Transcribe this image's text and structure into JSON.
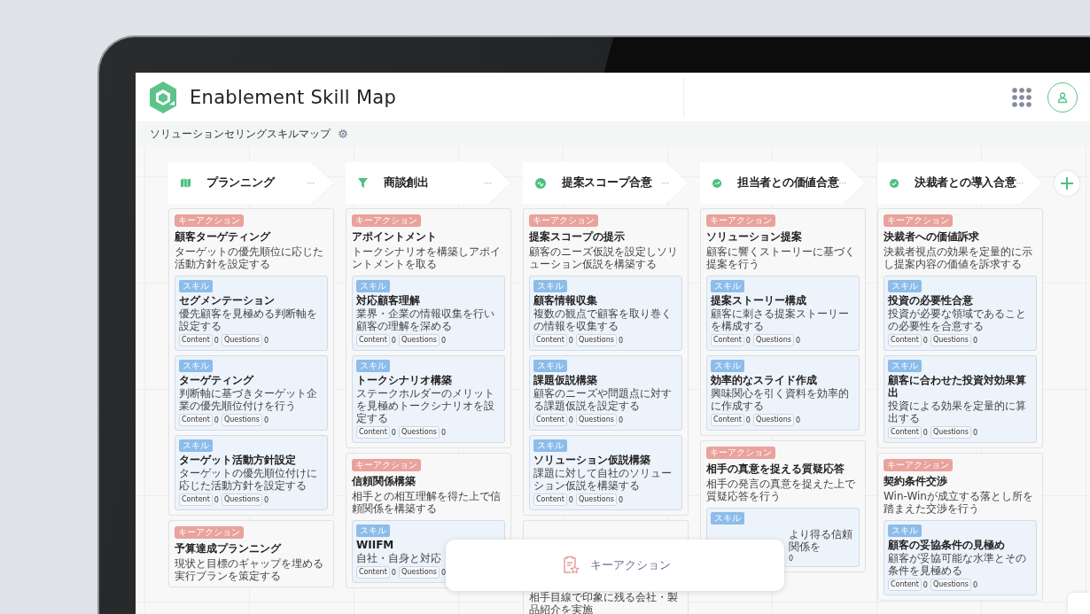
{
  "app": {
    "title": "Enablement Skill Map"
  },
  "map_title": "ソリューションセリングスキルマップ",
  "stages": [
    {
      "title": "プランニング",
      "menu": "···",
      "key_actions": [
        {
          "badge": "キーアクション",
          "title": "顧客ターゲティング",
          "description": "ターゲットの優先順位に応じた活動方針を設定する",
          "skills": [
            {
              "badge": "スキル",
              "title": "セグメンテーション",
              "description": "優先顧客を見極める判断軸を設定する",
              "stats": [
                {
                  "label": "Content",
                  "count": "0"
                },
                {
                  "label": "Questions",
                  "count": "0"
                }
              ]
            },
            {
              "badge": "スキル",
              "title": "ターゲティング",
              "description": "判断軸に基づきターゲット企業の優先順位付けを行う",
              "stats": [
                {
                  "label": "Content",
                  "count": "0"
                },
                {
                  "label": "Questions",
                  "count": "0"
                }
              ]
            },
            {
              "badge": "スキル",
              "title": "ターゲット活動方針設定",
              "description": "ターゲットの優先順位付けに応じた活動方針を設定する",
              "stats": [
                {
                  "label": "Content",
                  "count": "0"
                },
                {
                  "label": "Questions",
                  "count": "0"
                }
              ]
            }
          ]
        },
        {
          "badge": "キーアクション",
          "title": "予算達成プランニング",
          "description": "現状と目標のギャップを埋める実行プランを策定する"
        }
      ]
    },
    {
      "title": "商談創出",
      "menu": "···",
      "key_actions": [
        {
          "badge": "キーアクション",
          "title": "アポイントメント",
          "description": "トークシナリオを構築しアポイントメントを取る",
          "skills": [
            {
              "badge": "スキル",
              "title": "対応顧客理解",
              "description": "業界・企業の情報収集を行い顧客の理解を深める",
              "stats": [
                {
                  "label": "Content",
                  "count": "0"
                },
                {
                  "label": "Questions",
                  "count": "0"
                }
              ]
            },
            {
              "badge": "スキル",
              "title": "トークシナリオ構築",
              "description": "ステークホルダーのメリットを見極めトークシナリオを設定する",
              "stats": [
                {
                  "label": "Content",
                  "count": "0"
                },
                {
                  "label": "Questions",
                  "count": "0"
                }
              ]
            }
          ]
        },
        {
          "badge": "キーアクション",
          "title": "信頼関係構築",
          "description": "相手との相互理解を得た上で信頼関係を構築する",
          "skills": [
            {
              "badge": "スキル",
              "title": "WIIFM",
              "description": "自社・自身と対応",
              "stats": [
                {
                  "label": "Content",
                  "count": "0"
                },
                {
                  "label": "Questions",
                  "count": "0"
                }
              ]
            }
          ]
        }
      ]
    },
    {
      "title": "提案スコープ合意",
      "menu": "···",
      "key_actions": [
        {
          "badge": "キーアクション",
          "title": "提案スコープの提示",
          "description": "顧客のニーズ仮説を設定しソリューション仮説を構築する",
          "skills": [
            {
              "badge": "スキル",
              "title": "顧客情報収集",
              "description": "複数の観点で顧客を取り巻くの情報を収集する",
              "stats": [
                {
                  "label": "Content",
                  "count": "0"
                },
                {
                  "label": "Questions",
                  "count": "0"
                }
              ]
            },
            {
              "badge": "スキル",
              "title": "課題仮説構築",
              "description": "顧客のニーズや問題点に対する課題仮説を設定する",
              "stats": [
                {
                  "label": "Content",
                  "count": "0"
                },
                {
                  "label": "Questions",
                  "count": "0"
                }
              ]
            },
            {
              "badge": "スキル",
              "title": "ソリューション仮説構築",
              "description": "課題に対して自社のソリューション仮説を構築する",
              "stats": [
                {
                  "label": "Content",
                  "count": "0"
                },
                {
                  "label": "Questions",
                  "count": "0"
                }
              ]
            }
          ]
        },
        {
          "description": "相手目線で印象に残る会社・製品紹介を実施"
        }
      ]
    },
    {
      "title": "担当者との価値合意",
      "menu": "···",
      "key_actions": [
        {
          "badge": "キーアクション",
          "title": "ソリューション提案",
          "description": "顧客に響くストーリーに基づく提案を行う",
          "skills": [
            {
              "badge": "スキル",
              "title": "提案ストーリー構成",
              "description": "顧客に刺さる提案ストーリーを構成する",
              "stats": [
                {
                  "label": "Content",
                  "count": "0"
                },
                {
                  "label": "Questions",
                  "count": "0"
                }
              ]
            },
            {
              "badge": "スキル",
              "title": "効率的なスライド作成",
              "description": "興味関心を引く資料を効率的に作成する",
              "stats": [
                {
                  "label": "Content",
                  "count": "0"
                },
                {
                  "label": "Questions",
                  "count": "0"
                }
              ]
            }
          ]
        },
        {
          "badge": "キーアクション",
          "title": "相手の真意を捉える質疑応答",
          "description": "相手の発言の真意を捉えた上で質疑応答を行う",
          "skills": [
            {
              "badge": "スキル",
              "description": "より得る信頼関係を",
              "stats": [
                {
                  "count": "0"
                }
              ]
            }
          ]
        }
      ]
    },
    {
      "title": "決裁者との導入合意",
      "menu": "···",
      "key_actions": [
        {
          "badge": "キーアクション",
          "title": "決裁者への価値訴求",
          "description": "決裁者視点の効果を定量的に示し提案内容の価値を訴求する",
          "skills": [
            {
              "badge": "スキル",
              "title": "投資の必要性合意",
              "description": "投資が必要な領域であることの必要性を合意する",
              "stats": [
                {
                  "label": "Content",
                  "count": "0"
                },
                {
                  "label": "Questions",
                  "count": "0"
                }
              ]
            },
            {
              "badge": "スキル",
              "title": "顧客に合わせた投資対効果算出",
              "description": "投資による効果を定量的に算出する",
              "stats": [
                {
                  "label": "Content",
                  "count": "0"
                },
                {
                  "label": "Questions",
                  "count": "0"
                }
              ]
            }
          ]
        },
        {
          "badge": "キーアクション",
          "title": "契約条件交渉",
          "description": "Win-Winが成立する落とし所を踏まえた交渉を行う",
          "skills": [
            {
              "badge": "スキル",
              "title": "顧客の妥協条件の見極め",
              "description": "顧客が妥協可能な水準とその条件を見極める",
              "stats": [
                {
                  "label": "Content",
                  "count": "0"
                },
                {
                  "label": "Questions",
                  "count": "0"
                }
              ]
            }
          ]
        }
      ]
    }
  ],
  "toolbar": {
    "label": "キーアクション"
  }
}
